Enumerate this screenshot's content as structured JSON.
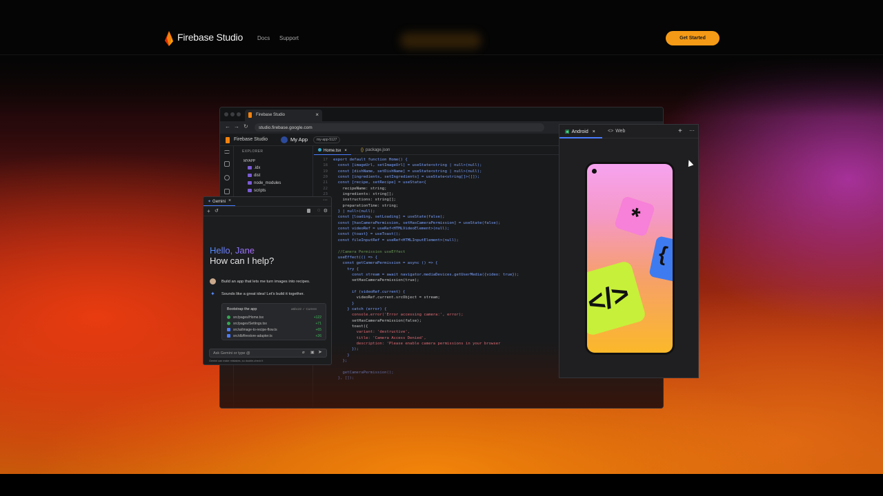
{
  "header": {
    "brand": "Firebase Studio",
    "nav": [
      "Docs",
      "Support"
    ],
    "cta": "Get Started"
  },
  "browser": {
    "tab_title": "Firebase Studio",
    "url": "studio.firebase.google.com",
    "ide": {
      "brand": "Firebase Studio",
      "project": "My App",
      "branch": "my-app-5127",
      "explorer_title": "EXPLORER",
      "root": "MYAPP",
      "files": [
        ".idx",
        "dist",
        "node_modules",
        "scripts"
      ],
      "tabs": [
        "Home.tsx",
        "package.json"
      ],
      "code_lines": [
        {
          "n": "17",
          "t": "export default function Home() {"
        },
        {
          "n": "18",
          "t": "  const [imageUrl, setImageUrl] = useState<string | null>(null);"
        },
        {
          "n": "19",
          "t": "  const [dishName, setDishName] = useState<string | null>(null);"
        },
        {
          "n": "20",
          "t": "  const [ingredients, setIngredients] = useState<string[]>([]);"
        },
        {
          "n": "21",
          "t": "  const [recipe, setRecipe] = useState<{"
        },
        {
          "n": "22",
          "t": "    recipeName: string;"
        },
        {
          "n": "23",
          "t": "    ingredients: string[];"
        },
        {
          "n": "24",
          "t": "    instructions: string[];"
        },
        {
          "n": "25",
          "t": "    preparationTime: string;"
        },
        {
          "n": "",
          "t": "  } | null>(null);"
        },
        {
          "n": "",
          "t": "  const [loading, setLoading] = useState(false);"
        },
        {
          "n": "",
          "t": "  const [hasCameraPermission, setHasCameraPermission] = useState(false);"
        },
        {
          "n": "",
          "t": "  const videoRef = useRef<HTMLVideoElement>(null);"
        },
        {
          "n": "",
          "t": "  const {toast} = useToast();"
        },
        {
          "n": "",
          "t": "  const fileInputRef = useRef<HTMLInputElement>(null);"
        },
        {
          "n": "",
          "t": ""
        },
        {
          "n": "",
          "t": "  //Camera Permission useEffect"
        },
        {
          "n": "",
          "t": "  useEffect(() => {"
        },
        {
          "n": "",
          "t": "    const getCameraPermission = async () => {"
        },
        {
          "n": "",
          "t": "      try {"
        },
        {
          "n": "",
          "t": "        const stream = await navigator.mediaDevices.getUserMedia({video: true});"
        },
        {
          "n": "",
          "t": "        setHasCameraPermission(true);"
        },
        {
          "n": "",
          "t": ""
        },
        {
          "n": "",
          "t": "        if (videoRef.current) {"
        },
        {
          "n": "",
          "t": "          videoRef.current.srcObject = stream;"
        },
        {
          "n": "",
          "t": "        }"
        },
        {
          "n": "",
          "t": "      } catch (error) {"
        },
        {
          "n": "",
          "t": "        console.error('Error accessing camera:', error);"
        },
        {
          "n": "",
          "t": "        setHasCameraPermission(false);"
        },
        {
          "n": "",
          "t": "        toast({"
        },
        {
          "n": "",
          "t": "          variant: 'destructive',"
        },
        {
          "n": "",
          "t": "          title: 'Camera Access Denied',"
        },
        {
          "n": "",
          "t": "          description: 'Please enable camera permissions in your browser"
        },
        {
          "n": "",
          "t": "        });"
        },
        {
          "n": "",
          "t": "      }"
        },
        {
          "n": "",
          "t": "    };"
        },
        {
          "n": "",
          "t": ""
        },
        {
          "n": "",
          "t": "    getCameraPermission();"
        },
        {
          "n": "",
          "t": "  }, []);"
        }
      ]
    }
  },
  "gemini": {
    "tab": "Gemini",
    "hello": "Hello, Jane",
    "help": "How can I help?",
    "user_msg": "Build an app that lets me turn images into recipes.",
    "bot_msg": "Sounds like a great idea! Let's build it together.",
    "card": {
      "title": "Bootstrap the app",
      "version": "a5bc22",
      "status": "Current",
      "files": [
        {
          "path": "src/pages/Home.tsx",
          "diff": "+122"
        },
        {
          "path": "src/pages/Settings.tsx",
          "diff": "+71"
        },
        {
          "path": "src/ai/image-to-recipe-flow.ts",
          "diff": "+65"
        },
        {
          "path": "src/db/firestore-adapter.ts",
          "diff": "+26"
        }
      ]
    },
    "input_placeholder": "Ask Gemini or type @",
    "disclaimer": "Gemini can make mistakes, so double-check it"
  },
  "preview": {
    "tabs": [
      "Android",
      "Web"
    ],
    "tile_glyphs": [
      "*",
      "{",
      "</>"
    ]
  }
}
